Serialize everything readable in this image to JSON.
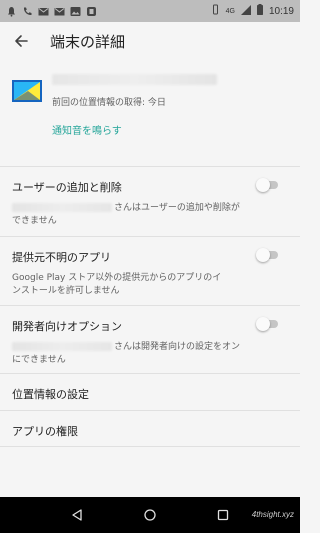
{
  "status_bar": {
    "network": "4G",
    "time": "10:19"
  },
  "app_bar": {
    "title": "端末の詳細"
  },
  "device": {
    "last_location": "前回の位置情報の取得: 今日",
    "ring_link": "通知音を鳴らす"
  },
  "settings": [
    {
      "title": "ユーザーの追加と削除",
      "desc_line1": "さんはユーザーの追加や削除が",
      "desc_line2": "できません",
      "toggle_on": false
    },
    {
      "title": "提供元不明のアプリ",
      "desc_line1": "Google Play ストア以外の提供元からのアプリのイ",
      "desc_line2": "ンストールを許可しません",
      "toggle_on": false
    },
    {
      "title": "開発者向けオプション",
      "desc_line1": "さんは開発者向けの設定をオン",
      "desc_line2": "にできません",
      "toggle_on": false
    }
  ],
  "links": {
    "location_settings": "位置情報の設定",
    "app_permissions": "アプリの権限"
  },
  "colors": {
    "accent": "#26a69a",
    "nav_bar": "#000000",
    "status_bar": "#bdbdbd"
  },
  "watermark": "4thsight.xyz"
}
